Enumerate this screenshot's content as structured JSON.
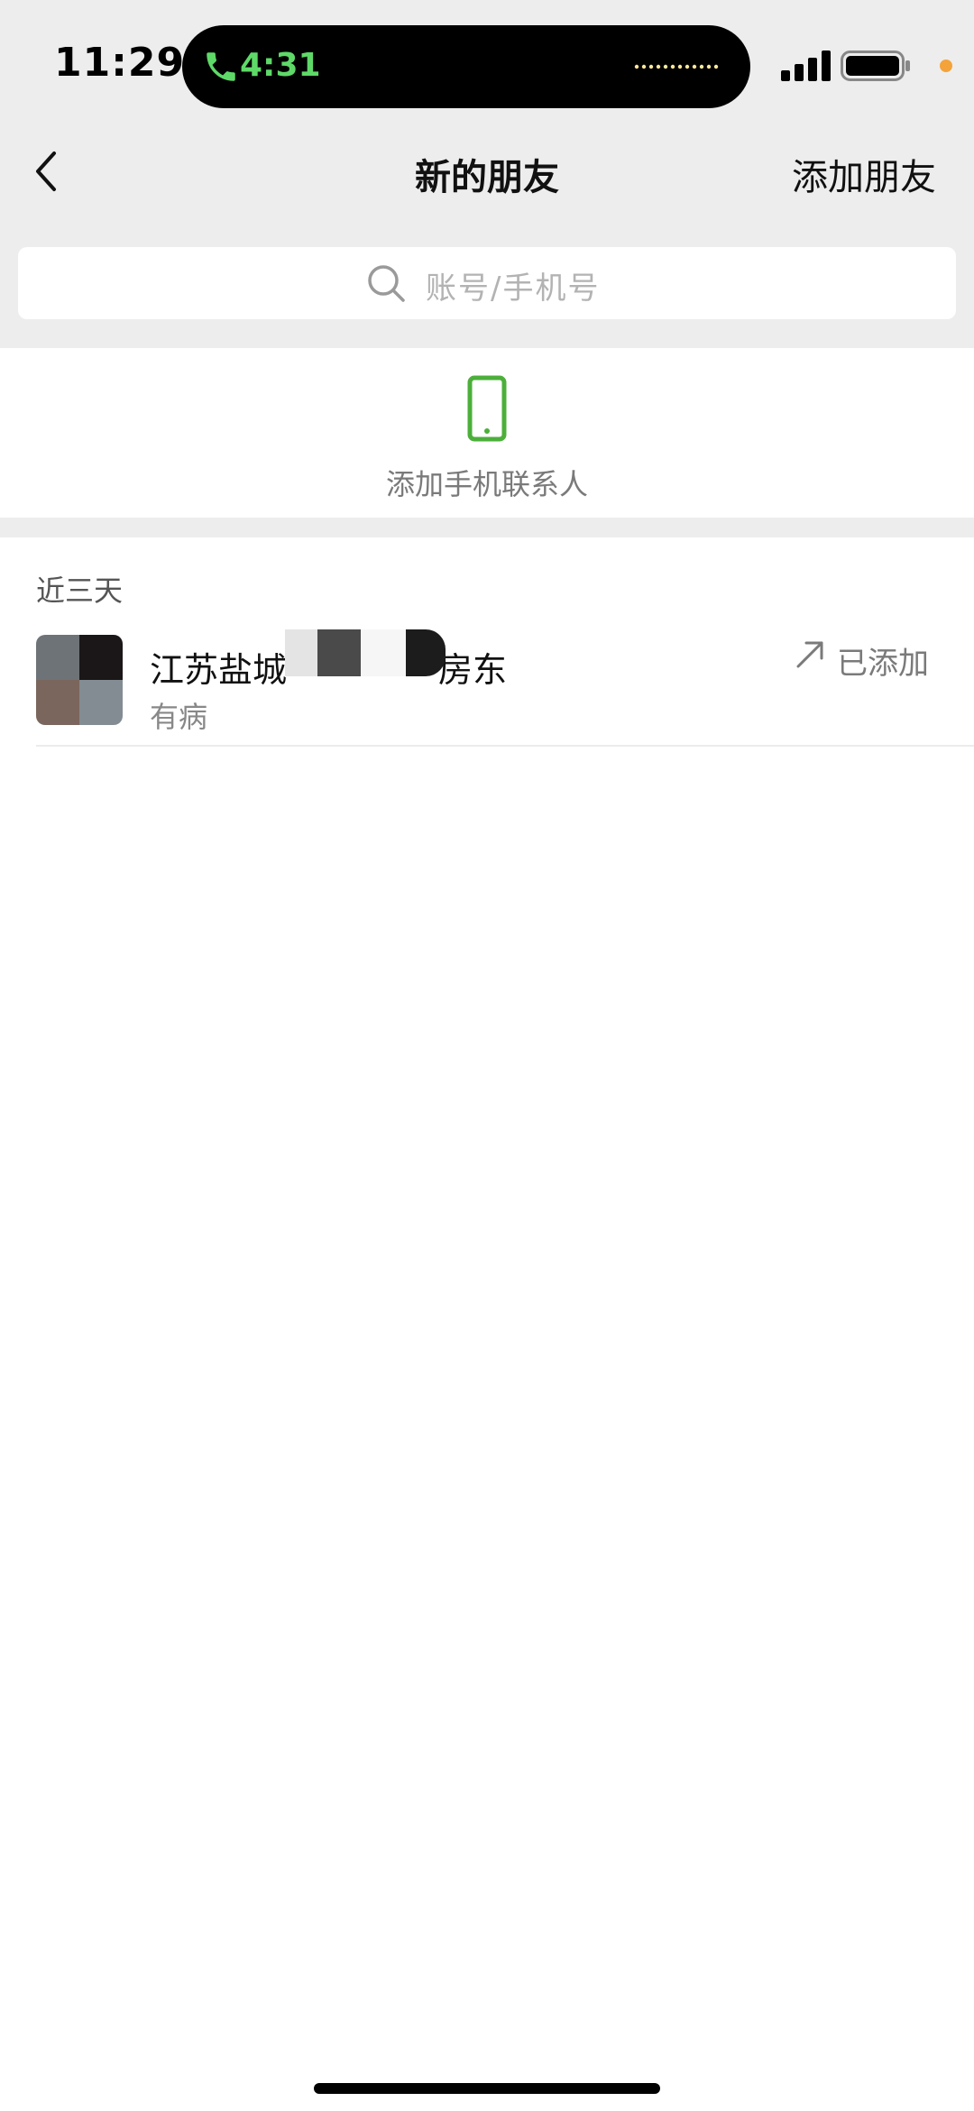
{
  "status_bar": {
    "time": "11:29",
    "call_duration": "4:31",
    "call_color": "#5ed968",
    "privacy_dot_color": "#f4a33b"
  },
  "nav": {
    "back_icon": "chevron-left-icon",
    "title": "新的朋友",
    "right_action": "添加朋友"
  },
  "search": {
    "icon": "search-icon",
    "placeholder": "账号/手机号"
  },
  "add_contacts": {
    "icon": "mobile-phone-icon",
    "icon_color": "#4caf3a",
    "label": "添加手机联系人"
  },
  "recent_section": {
    "title": "近三天",
    "items": [
      {
        "name_prefix": "江苏盐城",
        "name_suffix": "房东",
        "subtitle": "有病",
        "status_icon": "arrow-up-right-icon",
        "status": "已添加"
      }
    ]
  }
}
